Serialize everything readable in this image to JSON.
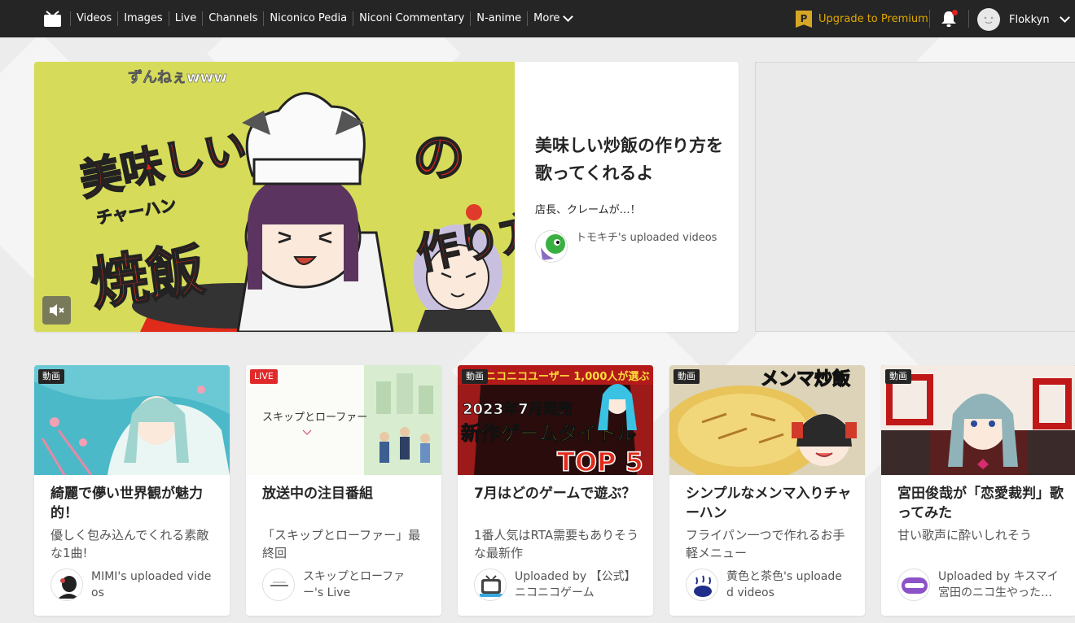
{
  "nav": {
    "items": [
      "Videos",
      "Images",
      "Live",
      "Channels",
      "Niconico Pedia",
      "Niconi Commentary",
      "N-anime"
    ],
    "more_label": "More",
    "premium_label": "Upgrade to Premium",
    "premium_badge": "P",
    "username": "Flokkyn"
  },
  "hero": {
    "thumb_caption_top": "ずんねぇwww",
    "thumb_text_1": "美味しい",
    "thumb_text_2": "チャーハン",
    "thumb_text_3": "焼飯",
    "thumb_text_4": "の",
    "thumb_text_5": "作り方",
    "title": "美味しい炒飯の作り方を歌ってくれるよ",
    "subtitle": "店長、クレームが…！",
    "uploader": "トモキチ's uploaded videos"
  },
  "cards": [
    {
      "tag": "動画",
      "title": "綺麗で儚い世界観が魅力的！",
      "subtitle": "優しく包み込んでくれる素敵な1曲!",
      "uploader": "MIMI's uploaded videos"
    },
    {
      "tag": "LIVE",
      "title": "放送中の注目番組",
      "subtitle": "「スキップとローファー」最終回",
      "uploader": "スキップとローファー's Live",
      "thumb_logo": "スキップとローファー"
    },
    {
      "tag": "動画",
      "title": "7月はどのゲームで遊ぶ？",
      "subtitle": "1番人気はRTA需要もありそうな最新作",
      "uploader": "Uploaded by 【公式】ニコニコゲーム",
      "thumb_banner": "ニコニコユーザー 1,000人が選ぶ",
      "thumb_line1": "2023年7月発売",
      "thumb_line2": "新作ゲームタイトル",
      "thumb_line3": "TOP 5"
    },
    {
      "tag": "動画",
      "title": "シンプルなメンマ入りチャーハン",
      "subtitle": "フライパン一つで作れるお手軽メニュー",
      "uploader": "黄色と茶色's uploaded videos",
      "thumb_text": "メンマ炒飯"
    },
    {
      "tag": "動画",
      "title": "宮田俊哉が「恋愛裁判」歌ってみた",
      "subtitle": "甘い歌声に酔いしれそう",
      "uploader": "Uploaded by キスマイ宮田のニコ生やった…"
    }
  ],
  "colors": {
    "topbar": "#252525",
    "premium": "#e0a800",
    "live": "#e02a2a",
    "background": "#ececec"
  }
}
